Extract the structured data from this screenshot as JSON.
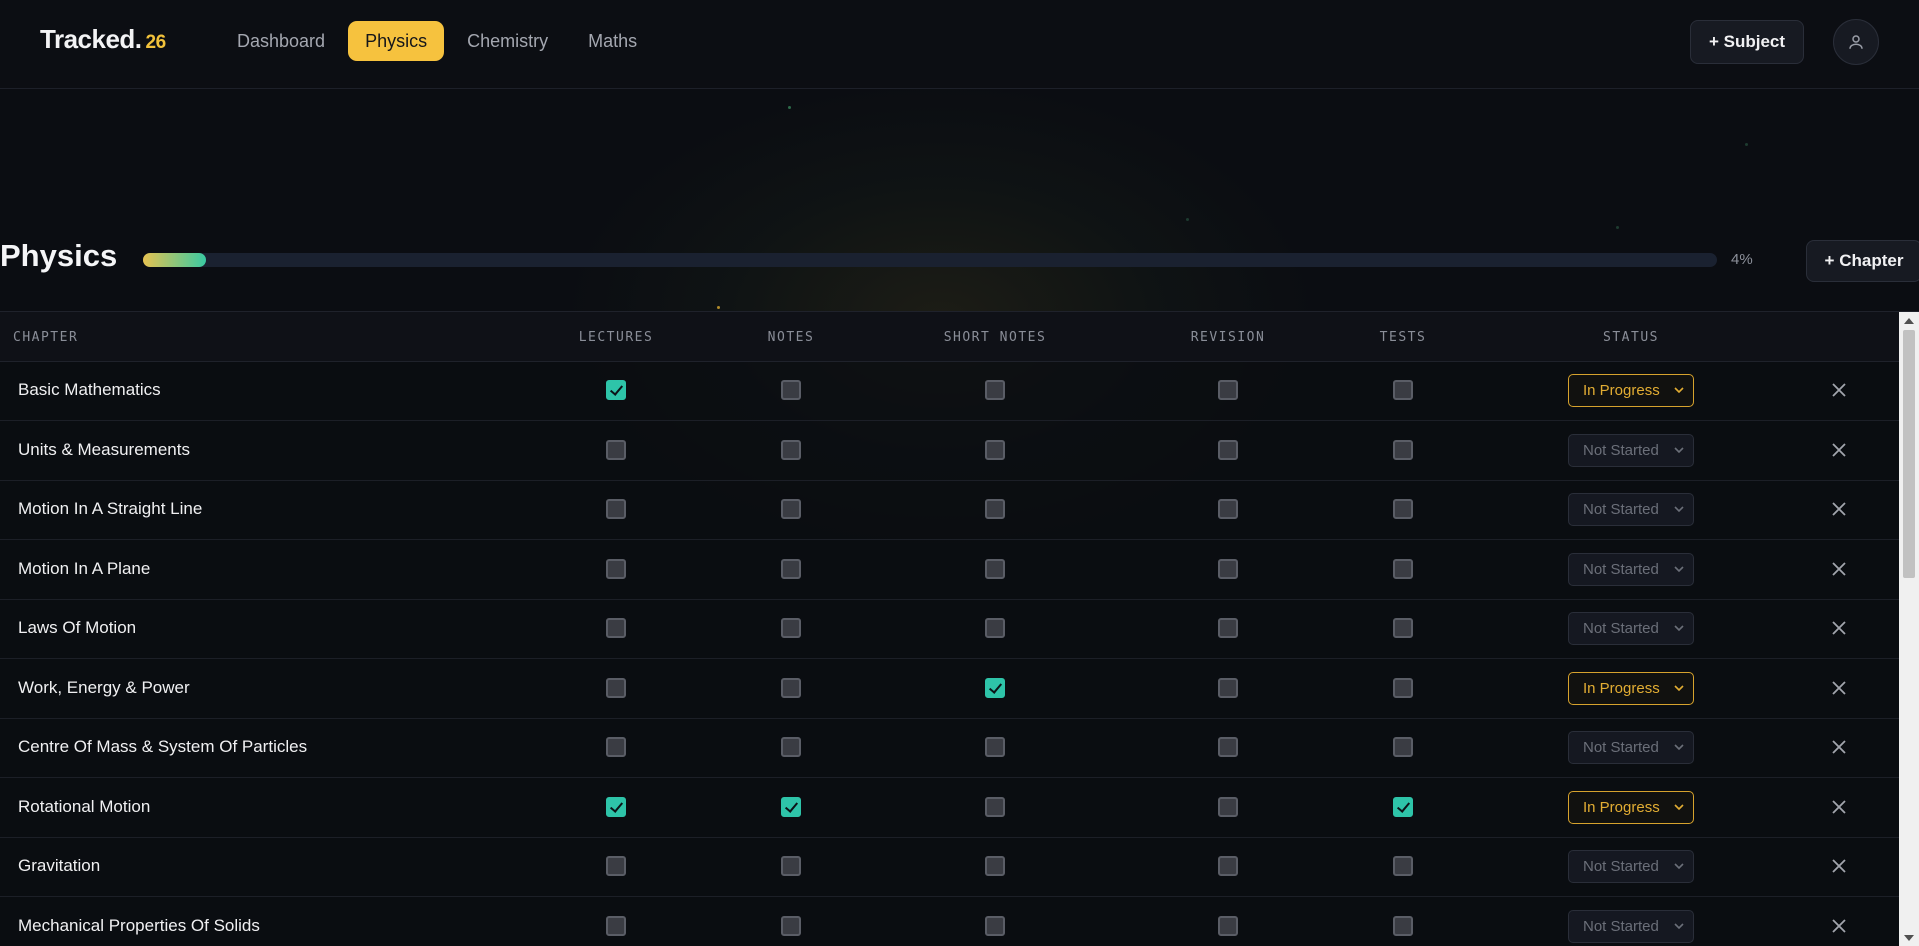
{
  "header": {
    "logo": "Tracked.",
    "logo_year": "26",
    "nav": [
      {
        "label": "Dashboard",
        "active": false
      },
      {
        "label": "Physics",
        "active": true
      },
      {
        "label": "Chemistry",
        "active": false
      },
      {
        "label": "Maths",
        "active": false
      }
    ],
    "add_subject_label": "+ Subject",
    "avatar_icon": "user-icon"
  },
  "subject": {
    "title": "Physics",
    "progress_percent": 4,
    "progress_label": "4%",
    "add_chapter_label": "+ Chapter"
  },
  "table": {
    "columns": [
      "CHAPTER",
      "LECTURES",
      "NOTES",
      "SHORT NOTES",
      "REVISION",
      "TESTS",
      "STATUS"
    ],
    "rows": [
      {
        "chapter": "Basic Mathematics",
        "checks": [
          true,
          false,
          false,
          false,
          false
        ],
        "status": "In Progress"
      },
      {
        "chapter": "Units & Measurements",
        "checks": [
          false,
          false,
          false,
          false,
          false
        ],
        "status": "Not Started"
      },
      {
        "chapter": "Motion In A Straight Line",
        "checks": [
          false,
          false,
          false,
          false,
          false
        ],
        "status": "Not Started"
      },
      {
        "chapter": "Motion In A Plane",
        "checks": [
          false,
          false,
          false,
          false,
          false
        ],
        "status": "Not Started"
      },
      {
        "chapter": "Laws Of Motion",
        "checks": [
          false,
          false,
          false,
          false,
          false
        ],
        "status": "Not Started"
      },
      {
        "chapter": "Work, Energy & Power",
        "checks": [
          false,
          false,
          true,
          false,
          false
        ],
        "status": "In Progress"
      },
      {
        "chapter": "Centre Of Mass & System Of Particles",
        "checks": [
          false,
          false,
          false,
          false,
          false
        ],
        "status": "Not Started"
      },
      {
        "chapter": "Rotational Motion",
        "checks": [
          true,
          true,
          false,
          false,
          true
        ],
        "status": "In Progress"
      },
      {
        "chapter": "Gravitation",
        "checks": [
          false,
          false,
          false,
          false,
          false
        ],
        "status": "Not Started"
      },
      {
        "chapter": "Mechanical Properties Of Solids",
        "checks": [
          false,
          false,
          false,
          false,
          false
        ],
        "status": "Not Started"
      }
    ]
  },
  "colors": {
    "accent": "#f6c23e",
    "check": "#2ec4a9",
    "in_progress": "#e2ad33",
    "background": "#0b0d12"
  }
}
